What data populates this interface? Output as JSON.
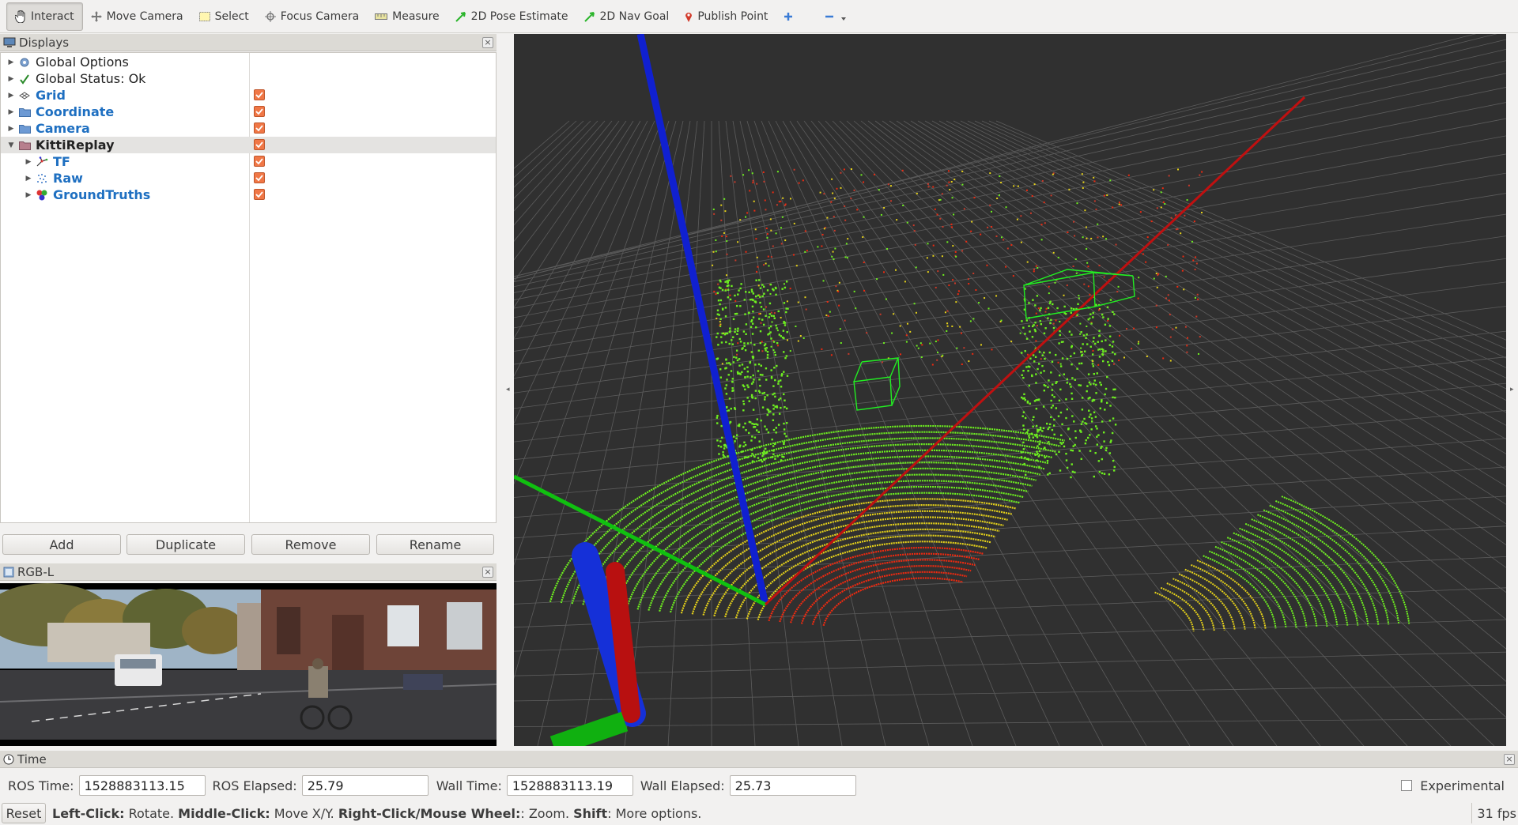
{
  "toolbar": {
    "interact": "Interact",
    "move_camera": "Move Camera",
    "select": "Select",
    "focus_camera": "Focus Camera",
    "measure": "Measure",
    "pose_estimate": "2D Pose Estimate",
    "nav_goal": "2D Nav Goal",
    "publish_point": "Publish Point"
  },
  "displays": {
    "title": "Displays",
    "items": [
      {
        "label": "Global Options",
        "icon": "gear-icon"
      },
      {
        "label": "Global Status: Ok",
        "icon": "check-icon"
      },
      {
        "label": "Grid",
        "icon": "grid-icon"
      },
      {
        "label": "Coordinate",
        "icon": "folder-icon"
      },
      {
        "label": "Camera",
        "icon": "folder-icon"
      },
      {
        "label": "KittiReplay",
        "icon": "folder-icon"
      },
      {
        "label": "TF",
        "icon": "tf-icon"
      },
      {
        "label": "Raw",
        "icon": "pointcloud-icon"
      },
      {
        "label": "GroundTruths",
        "icon": "markers-icon"
      }
    ],
    "buttons": {
      "add": "Add",
      "duplicate": "Duplicate",
      "remove": "Remove",
      "rename": "Rename"
    }
  },
  "image_panel": {
    "title": "RGB-L"
  },
  "time": {
    "title": "Time",
    "ros_time_label": "ROS Time:",
    "ros_time": "1528883113.15",
    "ros_elapsed_label": "ROS Elapsed:",
    "ros_elapsed": "25.79",
    "wall_time_label": "Wall Time:",
    "wall_time": "1528883113.19",
    "wall_elapsed_label": "Wall Elapsed:",
    "wall_elapsed": "25.73",
    "experimental": "Experimental"
  },
  "status": {
    "reset": "Reset",
    "left_click": "Left-Click:",
    "left_click_desc": " Rotate. ",
    "middle_click": "Middle-Click:",
    "middle_click_desc": " Move X/Y. ",
    "right_click": "Right-Click/Mouse Wheel:",
    "right_click_desc": ": Zoom. ",
    "shift": "Shift",
    "shift_desc": ": More options.",
    "fps": "31 fps"
  },
  "colors": {
    "accent_checkbox": "#f07746",
    "link_blue": "#1e6fc1",
    "viewport_bg": "#303030"
  }
}
